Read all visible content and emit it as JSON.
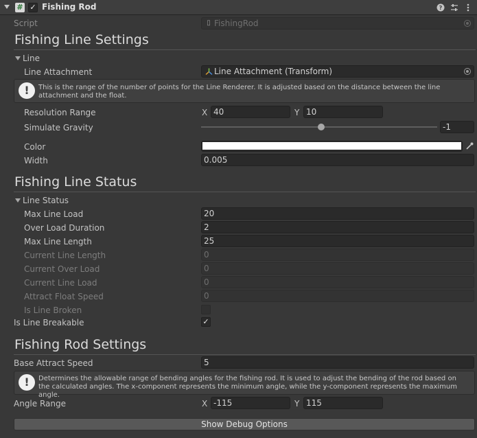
{
  "header": {
    "title": "Fishing Rod",
    "enabled": "✓",
    "icons": [
      "help-icon",
      "presets-icon",
      "menu-icon"
    ]
  },
  "script": {
    "label": "Script",
    "value": "FishingRod"
  },
  "line_settings": {
    "heading": "Fishing Line Settings",
    "group": "Line",
    "line_attachment": {
      "label": "Line Attachment",
      "value": "Line Attachment (Transform)"
    },
    "help": "This is the range of the number of points for the Line Renderer. It is adjusted based on the distance between the line attachment and the float.",
    "resolution_range": {
      "label": "Resolution Range",
      "x_label": "X",
      "x": "40",
      "y_label": "Y",
      "y": "10"
    },
    "simulate_gravity": {
      "label": "Simulate Gravity",
      "value": "-1",
      "slider_fraction": 0.5
    },
    "color": {
      "label": "Color",
      "value": "#ffffff"
    },
    "width": {
      "label": "Width",
      "value": "0.005"
    }
  },
  "line_status": {
    "heading": "Fishing Line Status",
    "group": "Line Status",
    "max_line_load": {
      "label": "Max Line Load",
      "value": "20"
    },
    "over_load_duration": {
      "label": "Over Load Duration",
      "value": "2"
    },
    "max_line_length": {
      "label": "Max Line Length",
      "value": "25"
    },
    "current_line_length": {
      "label": "Current Line Length",
      "value": "0"
    },
    "current_over_load": {
      "label": "Current Over Load",
      "value": "0"
    },
    "current_line_load": {
      "label": "Current Line Load",
      "value": "0"
    },
    "attract_float_speed": {
      "label": "Attract Float Speed",
      "value": "0"
    },
    "is_line_broken": {
      "label": "Is Line Broken",
      "value": ""
    },
    "is_line_breakable": {
      "label": "Is Line Breakable",
      "value": "✓"
    }
  },
  "rod_settings": {
    "heading": "Fishing Rod Settings",
    "base_attract_speed": {
      "label": "Base Attract Speed",
      "value": "5"
    },
    "help": "Determines the allowable range of bending angles for the fishing rod. It is used to adjust the bending of the rod based on the calculated angles. The x-component represents the minimum angle, while the y-component represents the maximum angle.",
    "angle_range": {
      "label": "Angle Range",
      "x_label": "X",
      "x": "-115",
      "y_label": "Y",
      "y": "115"
    }
  },
  "debug_button": "Show Debug Options"
}
